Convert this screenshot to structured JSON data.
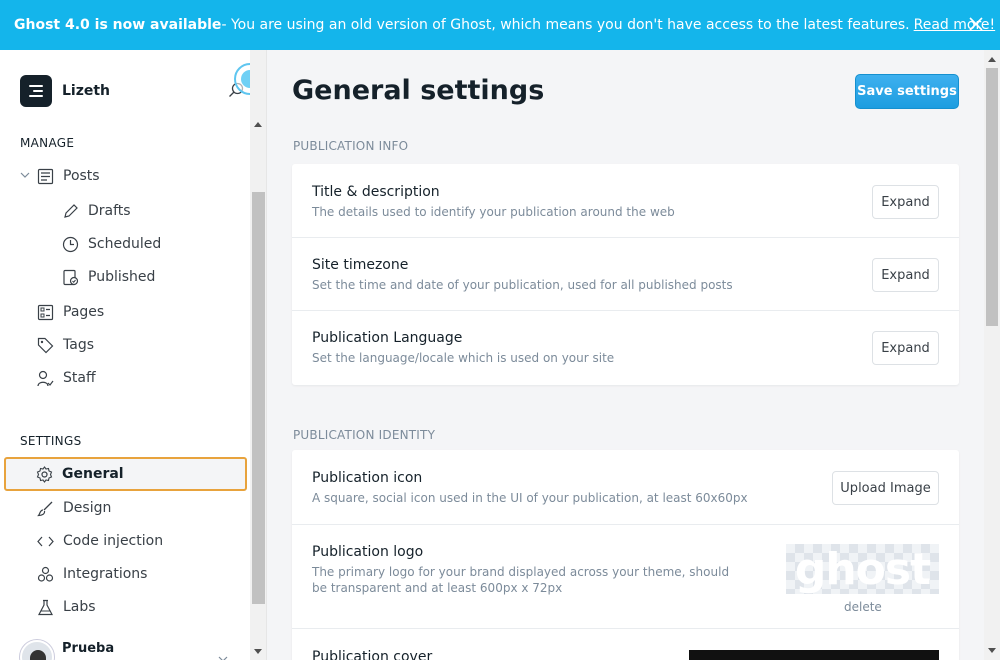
{
  "banner": {
    "bold": "Ghost 4.0 is now available",
    "text": " - You are using an old version of Ghost, which means you don't have access to the latest features.",
    "link": "Read more!"
  },
  "sidebar": {
    "site_name": "Lizeth",
    "manage_title": "MANAGE",
    "settings_title": "SETTINGS",
    "posts": "Posts",
    "drafts": "Drafts",
    "scheduled": "Scheduled",
    "published": "Published",
    "pages": "Pages",
    "tags": "Tags",
    "staff": "Staff",
    "general": "General",
    "design": "Design",
    "code_injection": "Code injection",
    "integrations": "Integrations",
    "labs": "Labs",
    "user_name": "Prueba"
  },
  "main": {
    "title": "General settings",
    "save_label": "Save settings",
    "pub_info_title": "PUBLICATION INFO",
    "pub_identity_title": "PUBLICATION IDENTITY",
    "rows": {
      "title_desc": {
        "title": "Title & description",
        "desc": "The details used to identify your publication around the web",
        "btn": "Expand"
      },
      "timezone": {
        "title": "Site timezone",
        "desc": "Set the time and date of your publication, used for all published posts",
        "btn": "Expand"
      },
      "language": {
        "title": "Publication Language",
        "desc": "Set the language/locale which is used on your site",
        "btn": "Expand"
      },
      "icon": {
        "title": "Publication icon",
        "desc": "A square, social icon used in the UI of your publication, at least 60x60px",
        "btn": "Upload Image"
      },
      "logo": {
        "title": "Publication logo",
        "desc1": "The primary logo for your brand displayed across your theme, should",
        "desc2": "be transparent and at least 600px x 72px",
        "logo_text": "ghost",
        "delete": "delete"
      },
      "cover": {
        "title": "Publication cover"
      }
    }
  },
  "colors": {
    "banner": "#14b5eb",
    "accent": "#3eb0ef",
    "active_outline": "#e8a33d"
  }
}
